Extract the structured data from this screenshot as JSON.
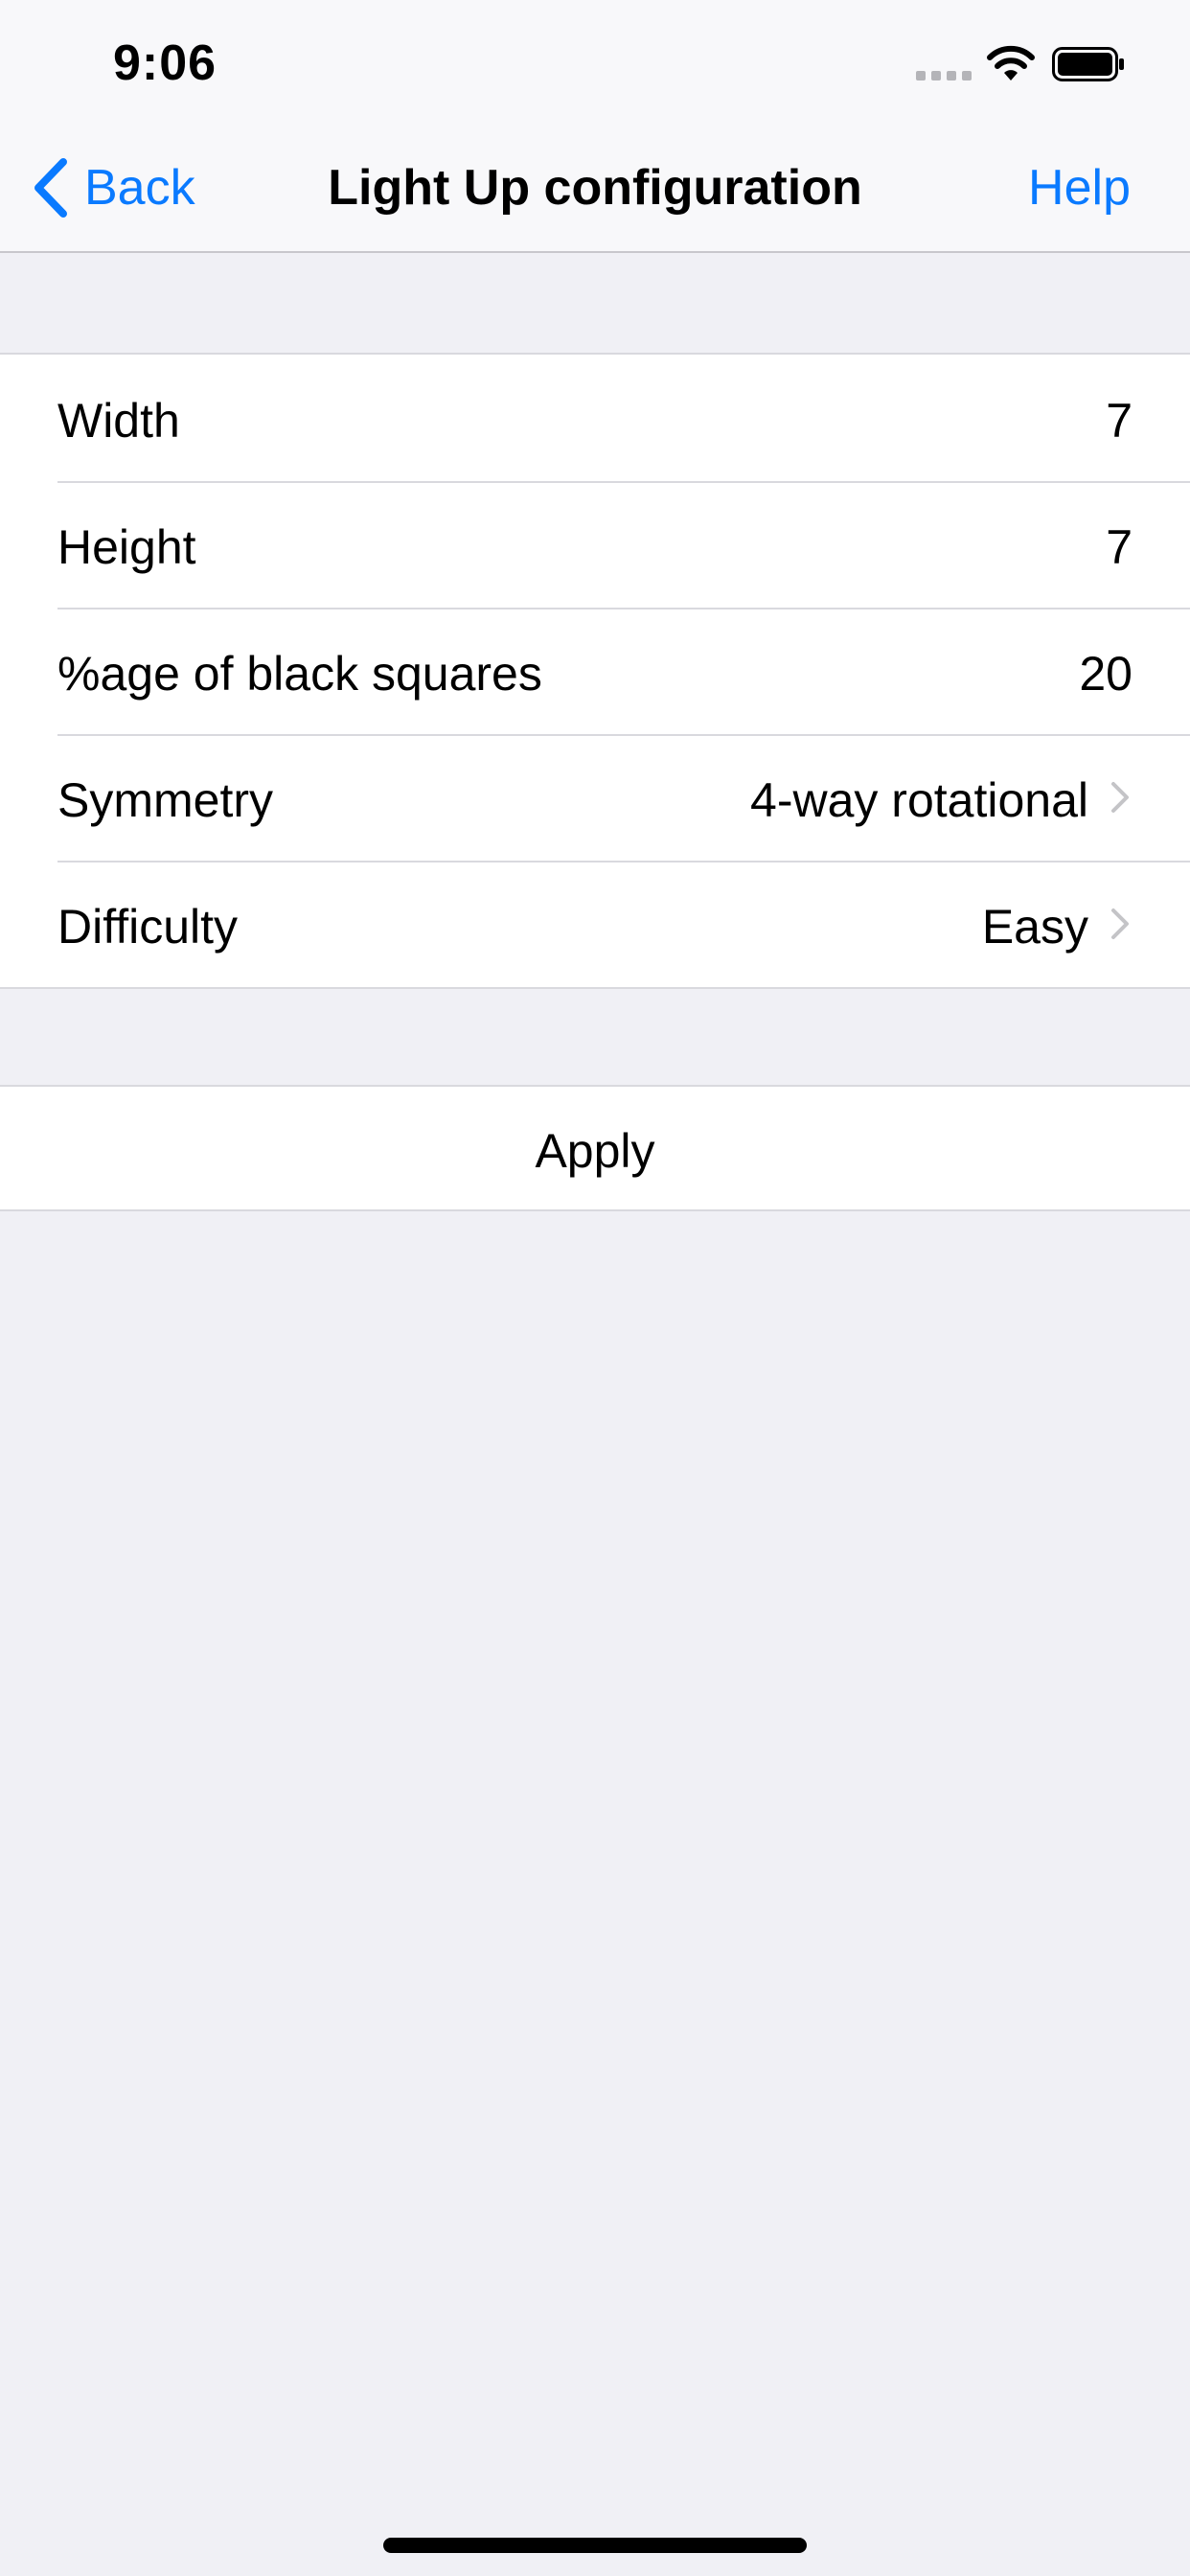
{
  "status_bar": {
    "time": "9:06"
  },
  "nav": {
    "back_label": "Back",
    "title": "Light Up configuration",
    "help_label": "Help"
  },
  "settings": [
    {
      "label": "Width",
      "value": "7"
    },
    {
      "label": "Height",
      "value": "7"
    },
    {
      "label": "%age of black squares",
      "value": "20"
    },
    {
      "label": "Symmetry",
      "value": "4-way rotational"
    },
    {
      "label": "Difficulty",
      "value": "Easy"
    }
  ],
  "apply_label": "Apply",
  "colors": {
    "accent": "#0a7aff",
    "background": "#f0f0f5",
    "cell": "#ffffff",
    "separator": "#d9d9de",
    "chevron": "#c4c4c7"
  },
  "icons": [
    "signal-icon",
    "wifi-icon",
    "battery-icon",
    "back-chevron-icon",
    "chevron-right-icon"
  ]
}
